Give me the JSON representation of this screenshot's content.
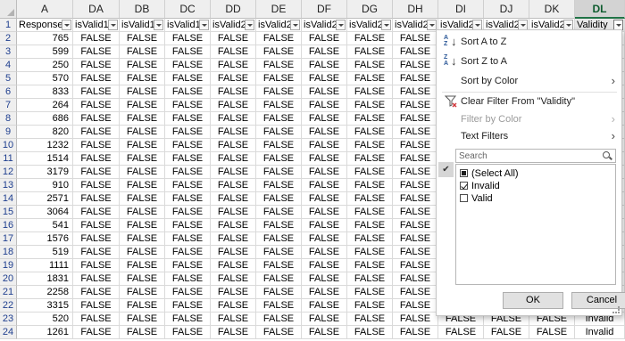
{
  "columns": [
    "A",
    "DA",
    "DB",
    "DC",
    "DD",
    "DE",
    "DF",
    "DG",
    "DH",
    "DI",
    "DJ",
    "DK",
    "DL"
  ],
  "header_row": [
    "Response",
    "isValid1",
    "isValid1",
    "isValid1",
    "isValid2",
    "isValid2",
    "isValid2",
    "isValid2",
    "isValid2",
    "isValid2",
    "isValid2",
    "isValid2",
    "Validity"
  ],
  "row_numbers": [
    "1",
    "2",
    "3",
    "4",
    "5",
    "6",
    "7",
    "8",
    "9",
    "10",
    "11",
    "12",
    "13",
    "14",
    "15",
    "16",
    "17",
    "18",
    "19",
    "20",
    "21",
    "22",
    "23",
    "24"
  ],
  "response_ids": [
    "765",
    "599",
    "250",
    "570",
    "833",
    "264",
    "686",
    "820",
    "1232",
    "1514",
    "3179",
    "910",
    "2571",
    "3064",
    "541",
    "1576",
    "519",
    "1111",
    "1831",
    "2258",
    "3315",
    "520",
    "1261"
  ],
  "bool_value": "FALSE",
  "validity_visible": [
    {
      "row": 23,
      "value": "Invalid"
    },
    {
      "row": 24,
      "value": "Invalid"
    }
  ],
  "filter_menu": {
    "sort_a_to_z": "Sort A to Z",
    "sort_z_to_a": "Sort Z to A",
    "sort_by_color": "Sort by Color",
    "clear_filter": "Clear Filter From \"Validity\"",
    "filter_by_color": "Filter by Color",
    "text_filters": "Text Filters",
    "search_placeholder": "Search",
    "items": [
      {
        "label": "(Select All)",
        "state": "partial"
      },
      {
        "label": "Invalid",
        "state": "checked"
      },
      {
        "label": "Valid",
        "state": "unchecked"
      }
    ],
    "ok_label": "OK",
    "cancel_label": "Cancel"
  },
  "colors": {
    "accent": "#217346",
    "row_header_text": "#1f3f8f",
    "sort_icon": "#2b5797"
  }
}
